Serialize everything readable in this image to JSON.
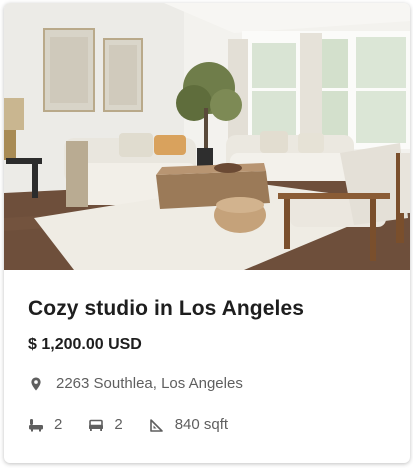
{
  "listing": {
    "title": "Cozy studio in Los Angeles",
    "price": "$ 1,200.00 USD",
    "address": "2263 Southlea, Los Angeles",
    "bathrooms": "2",
    "bedrooms": "2",
    "area": "840 sqft"
  },
  "icons": {
    "location": "location-pin-icon",
    "bath": "bathtub-icon",
    "bed": "bed-icon",
    "area": "area-ruler-icon"
  },
  "colors": {
    "text_primary": "#1e1e1e",
    "text_secondary": "#5f5f5f",
    "icon": "#5f5f5f"
  }
}
